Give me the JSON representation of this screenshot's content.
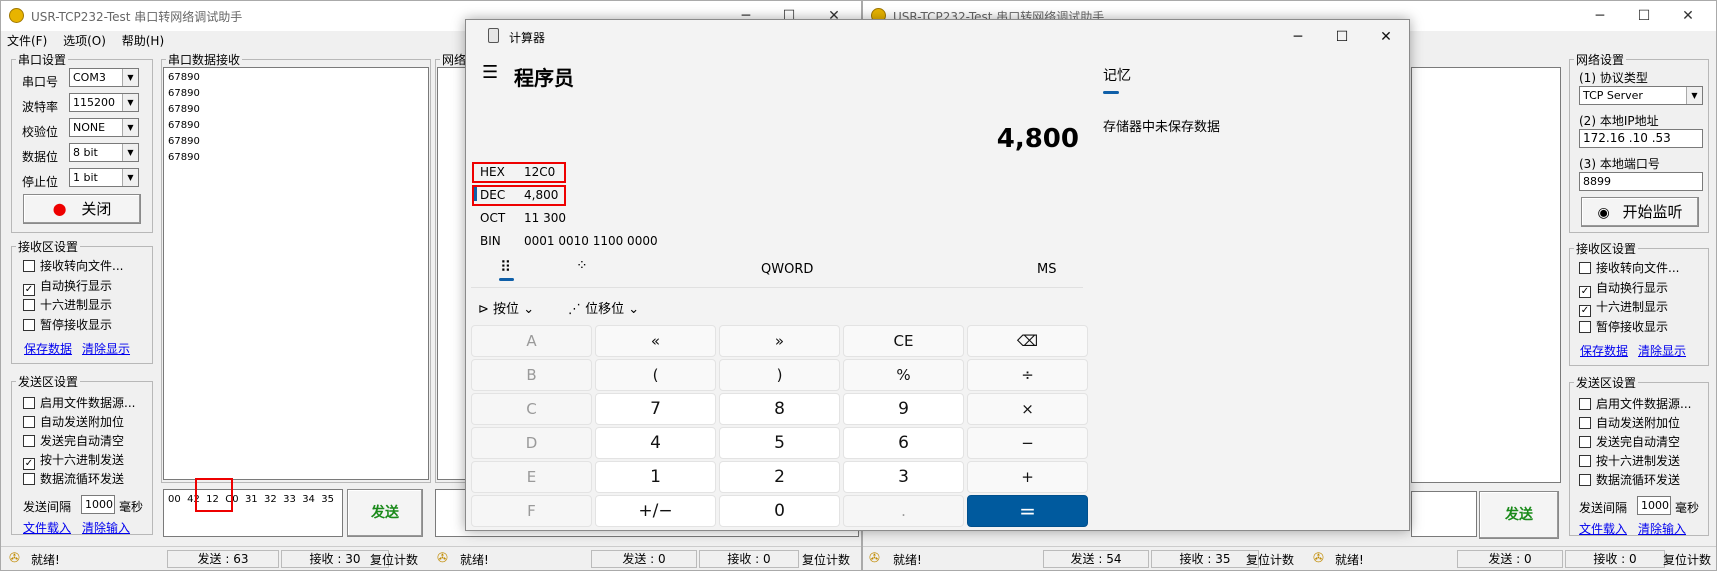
{
  "left_window": {
    "title": "USR-TCP232-Test 串口转网络调试助手",
    "menu": [
      "文件(F)",
      "选项(O)",
      "帮助(H)"
    ],
    "serial_group_title": "串口设置",
    "serial_rows": [
      {
        "label": "串口号",
        "value": "COM3"
      },
      {
        "label": "波特率",
        "value": "115200"
      },
      {
        "label": "校验位",
        "value": "NONE"
      },
      {
        "label": "数据位",
        "value": "8 bit"
      },
      {
        "label": "停止位",
        "value": "1 bit"
      }
    ],
    "close_button": "关闭",
    "recv_group_title": "接收区设置",
    "recv_options": [
      {
        "label": "接收转向文件...",
        "checked": false
      },
      {
        "label": "自动换行显示",
        "checked": true
      },
      {
        "label": "十六进制显示",
        "checked": false
      },
      {
        "label": "暂停接收显示",
        "checked": false
      }
    ],
    "recv_links": [
      "保存数据",
      "清除显示"
    ],
    "send_group_title": "发送区设置",
    "send_options": [
      {
        "label": "启用文件数据源...",
        "checked": false
      },
      {
        "label": "自动发送附加位",
        "checked": false
      },
      {
        "label": "发送完自动清空",
        "checked": false
      },
      {
        "label": "按十六进制发送",
        "checked": true
      },
      {
        "label": "数据流循环发送",
        "checked": false
      }
    ],
    "interval_label": "发送间隔",
    "interval_value": "1000",
    "interval_unit": "毫秒",
    "send_links": [
      "文件载入",
      "清除输入"
    ],
    "serial_recv_title": "串口数据接收",
    "serial_recv_lines": "67890\n67890\n67890\n67890\n67890\n67890",
    "network_title": "网络",
    "send_text": "00  42  12  C0  31  32  33  34  35",
    "send_button": "发送",
    "status": {
      "ready": "就绪!",
      "sent": "发送 : 63",
      "recv": "接收 : 30",
      "reset": "复位计数",
      "ready2": "就绪!",
      "sent2": "发送 : 0",
      "recv2": "接收 : 0",
      "reset2": "复位计数"
    }
  },
  "right_window": {
    "title": "USR-TCP232-Test 串口转网络调试助手",
    "net_group_title": "网络设置",
    "protocol_label": "(1) 协议类型",
    "protocol_value": "TCP Server",
    "ip_label": "(2) 本地IP地址",
    "ip_value": "172.16 .10 .53",
    "port_label": "(3) 本地端口号",
    "port_value": "8899",
    "listen_button": "开始监听",
    "recv_group_title": "接收区设置",
    "recv_options": [
      {
        "label": "接收转向文件...",
        "checked": false
      },
      {
        "label": "自动换行显示",
        "checked": true
      },
      {
        "label": "十六进制显示",
        "checked": true
      },
      {
        "label": "暂停接收显示",
        "checked": false
      }
    ],
    "recv_links": [
      "保存数据",
      "清除显示"
    ],
    "send_group_title": "发送区设置",
    "send_options": [
      {
        "label": "启用文件数据源...",
        "checked": false
      },
      {
        "label": "自动发送附加位",
        "checked": false
      },
      {
        "label": "发送完自动清空",
        "checked": false
      },
      {
        "label": "按十六进制发送",
        "checked": false
      },
      {
        "label": "数据流循环发送",
        "checked": false
      }
    ],
    "interval_label": "发送间隔",
    "interval_value": "1000",
    "interval_unit": "毫秒",
    "send_links": [
      "文件载入",
      "清除输入"
    ],
    "send_button": "发送",
    "status": {
      "ready": "就绪!",
      "sent": "发送 : 54",
      "recv": "接收 : 35",
      "reset": "复位计数",
      "ready2": "就绪!",
      "sent2": "发送 : 0",
      "recv2": "接收 : 0",
      "reset2": "复位计数"
    }
  },
  "calculator": {
    "title": "计算器",
    "mode": "程序员",
    "display": "4,800",
    "radix": [
      {
        "label": "HEX",
        "value": "12C0"
      },
      {
        "label": "DEC",
        "value": "4,800"
      },
      {
        "label": "OCT",
        "value": "11 300"
      },
      {
        "label": "BIN",
        "value": "0001 0010 1100 0000"
      }
    ],
    "word_size": "QWORD",
    "ms": "MS",
    "bitwise": "按位",
    "bitshift": "位移位",
    "memory_tab": "记忆",
    "memory_empty": "存储器中未保存数据",
    "keys": [
      [
        "A",
        "«",
        "»",
        "CE",
        "⌫"
      ],
      [
        "B",
        "(",
        ")",
        "%",
        "÷"
      ],
      [
        "C",
        "7",
        "8",
        "9",
        "×"
      ],
      [
        "D",
        "4",
        "5",
        "6",
        "−"
      ],
      [
        "E",
        "1",
        "2",
        "3",
        "+"
      ],
      [
        "F",
        "+/−",
        "0",
        ".",
        "="
      ]
    ]
  }
}
